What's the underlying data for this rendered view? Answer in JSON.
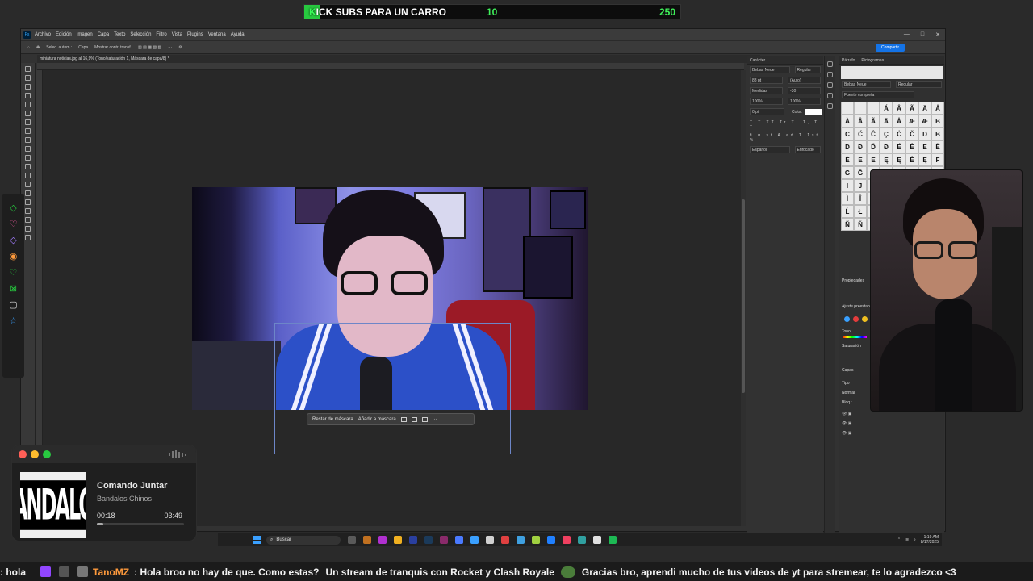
{
  "overlay": {
    "goal_prefix": "K",
    "goal_title": "ICK SUBS PARA UN CARRO",
    "goal_current": "10",
    "goal_target": "250",
    "goal_progress": 0.04
  },
  "photoshop": {
    "menu": [
      "Archivo",
      "Edición",
      "Imagen",
      "Capa",
      "Texto",
      "Selección",
      "Filtro",
      "Vista",
      "Plugins",
      "Ventana",
      "Ayuda"
    ],
    "window_controls": [
      "—",
      "□",
      "✕"
    ],
    "options_bar": {
      "select_label": "Selec. autom.:",
      "select_value": "Capa",
      "show_transform": "Mostrar contr. transf."
    },
    "share_label": "Compartir",
    "document_tab": "miniatura noticias.jpg al 16,9% (Tono/saturación 1, Máscara de capa/8) *",
    "context_bar": {
      "subtract": "Restar de máscara",
      "add": "Añadir a máscara",
      "more": "···"
    },
    "character_panel": {
      "title": "Carácter",
      "font": "Bebas Neue",
      "style": "Regular",
      "size": "88 pt",
      "leading": "(Auto)",
      "kerning": "Medidas",
      "tracking": "-30",
      "vscale": "100%",
      "hscale": "100%",
      "baseline": "0 pt",
      "color_label": "Color:",
      "language": "Español",
      "antialias": "Enfocado"
    },
    "glyphs_panel": {
      "tab1": "Párrafo",
      "tab2": "Pictogramas",
      "font": "Bebas Neue",
      "style": "Regular",
      "subset": "Fuente completa",
      "glyphs": [
        "",
        "",
        "",
        "Á",
        "Â",
        "Ã",
        "Ä",
        "Å",
        "À",
        "Â",
        "Ã",
        "Ä",
        "Å",
        "Æ",
        "Æ",
        "B",
        "C",
        "Ć",
        "Ĉ",
        "Ç",
        "Ċ",
        "Č",
        "D",
        "B",
        "D",
        "Đ",
        "Ď",
        "Đ",
        "É",
        "Ê",
        "Ë",
        "Ě",
        "È",
        "Ė",
        "Ē",
        "Ę",
        "Ę",
        "Ê",
        "Ę",
        "F",
        "G",
        "Ĝ",
        "",
        "",
        "",
        "",
        "",
        "",
        "I",
        "J",
        "",
        "",
        "",
        "",
        "",
        "",
        "Ì",
        "Î",
        "",
        "",
        "",
        "",
        "",
        "",
        "Ĺ",
        "Ł",
        "",
        "",
        "",
        "",
        "",
        "",
        "Ñ",
        "Ň",
        "",
        "",
        "",
        "",
        "",
        ""
      ]
    },
    "properties_panel": {
      "title": "Propiedades",
      "preset": "Ajuste preestab.",
      "hue": "Tono",
      "saturation": "Saturación",
      "swatch_colors": [
        "#39a0ff",
        "#e43c3c",
        "#f0c020"
      ]
    },
    "layers_panel": {
      "title": "Capas",
      "kind": "Tipo",
      "blend": "Normal",
      "lock": "Bloq.:"
    }
  },
  "taskbar": {
    "search_placeholder": "Buscar",
    "time": "1:19 AM",
    "date": "8/17/2025",
    "app_icon_colors": [
      "#5a5a5a",
      "#c07020",
      "#b030d0",
      "#f0b020",
      "#2a3f9f",
      "#1b3a5a",
      "#8a2a6a",
      "#4a7aff",
      "#3aa0ff",
      "#d0d0d0",
      "#e04040",
      "#3fa0e0",
      "#a0d040",
      "#2080ff",
      "#f04060",
      "#30a0a0",
      "#e0e0e0",
      "#1db954"
    ]
  },
  "music": {
    "album_text": "VANDALOS",
    "song": "Comando Juntar",
    "artist": "Bandalos Chinos",
    "elapsed": "00:18",
    "total": "03:49",
    "progress": 0.078
  },
  "ticker": {
    "lead": ": hola",
    "user": "TanoMZ",
    "message1": ": Hola broo no hay de que. Como estas?",
    "message2": "Un stream de tranquis con Rocket y Clash Royale",
    "message3": "Gracias bro, aprendi mucho de tus videos de yt para stremear, te lo agradezco <3"
  },
  "colors": {
    "accent": "#1473e6",
    "goal_green": "#3ff05a",
    "username": "#ff9a3c"
  }
}
